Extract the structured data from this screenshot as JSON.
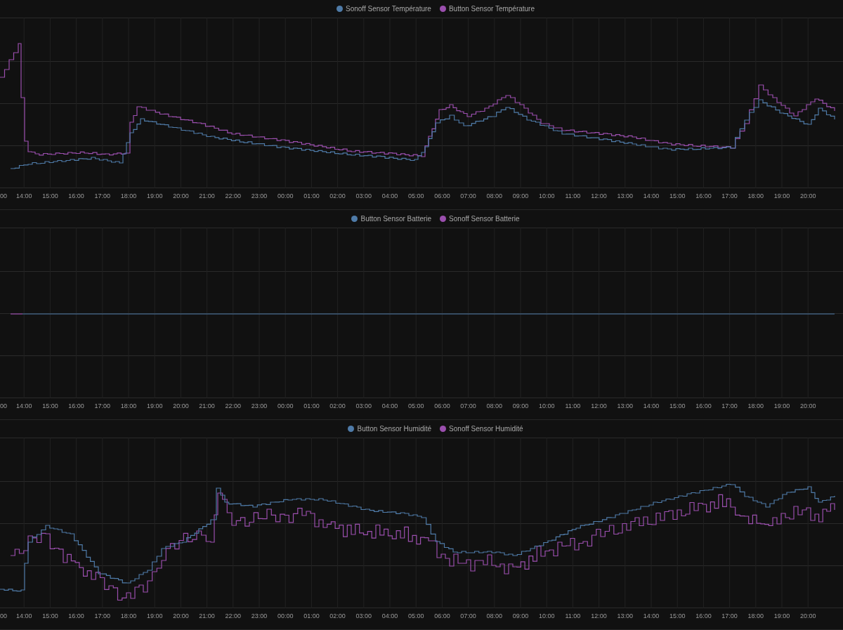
{
  "charts": [
    {
      "legend": [
        {
          "label": "Sonoff Sensor Température",
          "color": "#4f7ba8"
        },
        {
          "label": "Button Sensor Température",
          "color": "#9b4fae"
        }
      ],
      "x_labels": [
        "00",
        "14:00",
        "15:00",
        "16:00",
        "17:00",
        "18:00",
        "19:00",
        "20:00",
        "21:00",
        "22:00",
        "23:00",
        "00:00",
        "01:00",
        "02:00",
        "03:00",
        "04:00",
        "05:00",
        "06:00",
        "07:00",
        "08:00",
        "09:00",
        "10:00",
        "11:00",
        "12:00",
        "13:00",
        "14:00",
        "15:00",
        "16:00",
        "17:00",
        "18:00",
        "19:00",
        "20:00"
      ]
    },
    {
      "legend": [
        {
          "label": "Button Sensor Batterie",
          "color": "#4f7ba8"
        },
        {
          "label": "Sonoff Sensor Batterie",
          "color": "#9b4fae"
        }
      ],
      "x_labels": [
        "00",
        "14:00",
        "15:00",
        "16:00",
        "17:00",
        "18:00",
        "19:00",
        "20:00",
        "21:00",
        "22:00",
        "23:00",
        "00:00",
        "01:00",
        "02:00",
        "03:00",
        "04:00",
        "05:00",
        "06:00",
        "07:00",
        "08:00",
        "09:00",
        "10:00",
        "11:00",
        "12:00",
        "13:00",
        "14:00",
        "15:00",
        "16:00",
        "17:00",
        "18:00",
        "19:00",
        "20:00"
      ]
    },
    {
      "legend": [
        {
          "label": "Button Sensor Humidité",
          "color": "#4f7ba8"
        },
        {
          "label": "Sonoff Sensor Humidité",
          "color": "#9b4fae"
        }
      ],
      "x_labels": [
        "00",
        "14:00",
        "15:00",
        "16:00",
        "17:00",
        "18:00",
        "19:00",
        "20:00",
        "21:00",
        "22:00",
        "23:00",
        "00:00",
        "01:00",
        "02:00",
        "03:00",
        "04:00",
        "05:00",
        "06:00",
        "07:00",
        "08:00",
        "09:00",
        "10:00",
        "11:00",
        "12:00",
        "13:00",
        "14:00",
        "15:00",
        "16:00",
        "17:00",
        "18:00",
        "19:00",
        "20:00"
      ]
    }
  ]
}
